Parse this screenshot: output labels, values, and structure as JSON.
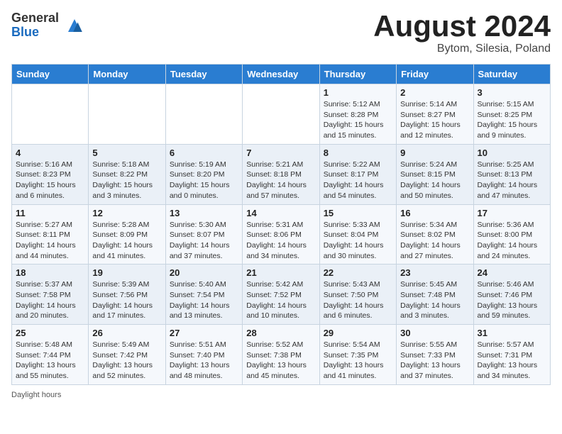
{
  "header": {
    "logo_general": "General",
    "logo_blue": "Blue",
    "title": "August 2024",
    "location": "Bytom, Silesia, Poland"
  },
  "days_of_week": [
    "Sunday",
    "Monday",
    "Tuesday",
    "Wednesday",
    "Thursday",
    "Friday",
    "Saturday"
  ],
  "weeks": [
    [
      {
        "day": "",
        "info": ""
      },
      {
        "day": "",
        "info": ""
      },
      {
        "day": "",
        "info": ""
      },
      {
        "day": "",
        "info": ""
      },
      {
        "day": "1",
        "info": "Sunrise: 5:12 AM\nSunset: 8:28 PM\nDaylight: 15 hours and 15 minutes."
      },
      {
        "day": "2",
        "info": "Sunrise: 5:14 AM\nSunset: 8:27 PM\nDaylight: 15 hours and 12 minutes."
      },
      {
        "day": "3",
        "info": "Sunrise: 5:15 AM\nSunset: 8:25 PM\nDaylight: 15 hours and 9 minutes."
      }
    ],
    [
      {
        "day": "4",
        "info": "Sunrise: 5:16 AM\nSunset: 8:23 PM\nDaylight: 15 hours and 6 minutes."
      },
      {
        "day": "5",
        "info": "Sunrise: 5:18 AM\nSunset: 8:22 PM\nDaylight: 15 hours and 3 minutes."
      },
      {
        "day": "6",
        "info": "Sunrise: 5:19 AM\nSunset: 8:20 PM\nDaylight: 15 hours and 0 minutes."
      },
      {
        "day": "7",
        "info": "Sunrise: 5:21 AM\nSunset: 8:18 PM\nDaylight: 14 hours and 57 minutes."
      },
      {
        "day": "8",
        "info": "Sunrise: 5:22 AM\nSunset: 8:17 PM\nDaylight: 14 hours and 54 minutes."
      },
      {
        "day": "9",
        "info": "Sunrise: 5:24 AM\nSunset: 8:15 PM\nDaylight: 14 hours and 50 minutes."
      },
      {
        "day": "10",
        "info": "Sunrise: 5:25 AM\nSunset: 8:13 PM\nDaylight: 14 hours and 47 minutes."
      }
    ],
    [
      {
        "day": "11",
        "info": "Sunrise: 5:27 AM\nSunset: 8:11 PM\nDaylight: 14 hours and 44 minutes."
      },
      {
        "day": "12",
        "info": "Sunrise: 5:28 AM\nSunset: 8:09 PM\nDaylight: 14 hours and 41 minutes."
      },
      {
        "day": "13",
        "info": "Sunrise: 5:30 AM\nSunset: 8:07 PM\nDaylight: 14 hours and 37 minutes."
      },
      {
        "day": "14",
        "info": "Sunrise: 5:31 AM\nSunset: 8:06 PM\nDaylight: 14 hours and 34 minutes."
      },
      {
        "day": "15",
        "info": "Sunrise: 5:33 AM\nSunset: 8:04 PM\nDaylight: 14 hours and 30 minutes."
      },
      {
        "day": "16",
        "info": "Sunrise: 5:34 AM\nSunset: 8:02 PM\nDaylight: 14 hours and 27 minutes."
      },
      {
        "day": "17",
        "info": "Sunrise: 5:36 AM\nSunset: 8:00 PM\nDaylight: 14 hours and 24 minutes."
      }
    ],
    [
      {
        "day": "18",
        "info": "Sunrise: 5:37 AM\nSunset: 7:58 PM\nDaylight: 14 hours and 20 minutes."
      },
      {
        "day": "19",
        "info": "Sunrise: 5:39 AM\nSunset: 7:56 PM\nDaylight: 14 hours and 17 minutes."
      },
      {
        "day": "20",
        "info": "Sunrise: 5:40 AM\nSunset: 7:54 PM\nDaylight: 14 hours and 13 minutes."
      },
      {
        "day": "21",
        "info": "Sunrise: 5:42 AM\nSunset: 7:52 PM\nDaylight: 14 hours and 10 minutes."
      },
      {
        "day": "22",
        "info": "Sunrise: 5:43 AM\nSunset: 7:50 PM\nDaylight: 14 hours and 6 minutes."
      },
      {
        "day": "23",
        "info": "Sunrise: 5:45 AM\nSunset: 7:48 PM\nDaylight: 14 hours and 3 minutes."
      },
      {
        "day": "24",
        "info": "Sunrise: 5:46 AM\nSunset: 7:46 PM\nDaylight: 13 hours and 59 minutes."
      }
    ],
    [
      {
        "day": "25",
        "info": "Sunrise: 5:48 AM\nSunset: 7:44 PM\nDaylight: 13 hours and 55 minutes."
      },
      {
        "day": "26",
        "info": "Sunrise: 5:49 AM\nSunset: 7:42 PM\nDaylight: 13 hours and 52 minutes."
      },
      {
        "day": "27",
        "info": "Sunrise: 5:51 AM\nSunset: 7:40 PM\nDaylight: 13 hours and 48 minutes."
      },
      {
        "day": "28",
        "info": "Sunrise: 5:52 AM\nSunset: 7:38 PM\nDaylight: 13 hours and 45 minutes."
      },
      {
        "day": "29",
        "info": "Sunrise: 5:54 AM\nSunset: 7:35 PM\nDaylight: 13 hours and 41 minutes."
      },
      {
        "day": "30",
        "info": "Sunrise: 5:55 AM\nSunset: 7:33 PM\nDaylight: 13 hours and 37 minutes."
      },
      {
        "day": "31",
        "info": "Sunrise: 5:57 AM\nSunset: 7:31 PM\nDaylight: 13 hours and 34 minutes."
      }
    ]
  ],
  "footer": {
    "daylight_label": "Daylight hours"
  }
}
